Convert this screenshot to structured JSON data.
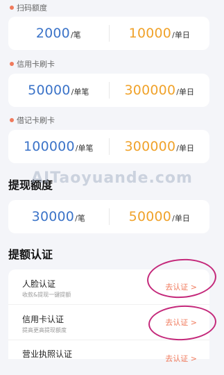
{
  "scan_quota": {
    "label": "扫码额度",
    "left": {
      "value": "2000",
      "unit": "/笔"
    },
    "right": {
      "value": "10000",
      "unit": "/单日"
    }
  },
  "credit_quota": {
    "label": "信用卡刷卡",
    "left": {
      "value": "50000",
      "unit": "/单笔"
    },
    "right": {
      "value": "300000",
      "unit": "/单日"
    }
  },
  "debit_quota": {
    "label": "借记卡刷卡",
    "left": {
      "value": "100000",
      "unit": "/单笔"
    },
    "right": {
      "value": "300000",
      "unit": "/单日"
    }
  },
  "withdraw": {
    "heading": "提现额度",
    "left": {
      "value": "30000",
      "unit": "/笔"
    },
    "right": {
      "value": "50000",
      "unit": "/单日"
    }
  },
  "watermark": "AITaoyuande.com",
  "verify": {
    "heading": "提额认证",
    "items": [
      {
        "title": "人脸认证",
        "subtitle": "收款&提现一键提额",
        "action": "去认证 >"
      },
      {
        "title": "信用卡认证",
        "subtitle": "提高更高提现额度",
        "action": "去认证 >"
      },
      {
        "title": "营业执照认证",
        "subtitle": "",
        "action": "去认证 >"
      }
    ]
  },
  "colors": {
    "blue": "#3b73c8",
    "orange": "#f0a22a",
    "accent": "#f07a5c",
    "annotation": "#c4287a"
  }
}
